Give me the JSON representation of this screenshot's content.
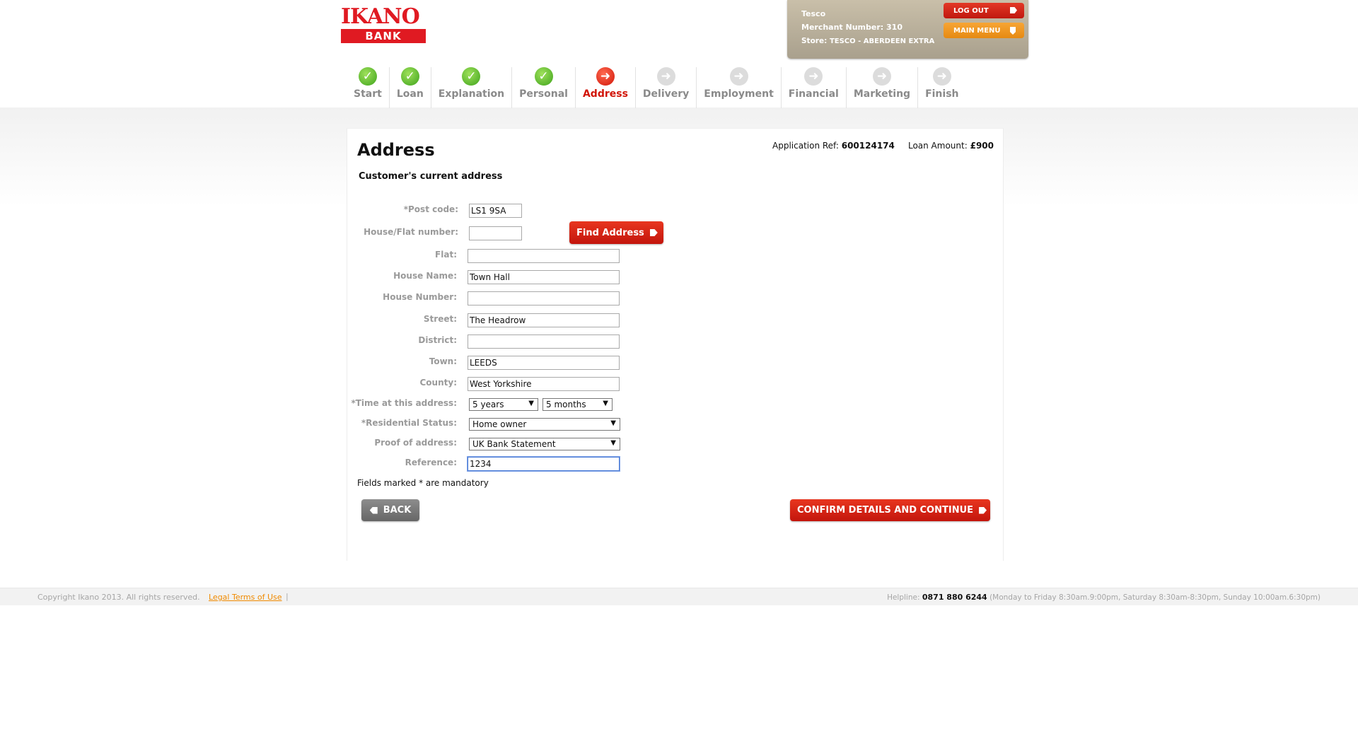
{
  "header": {
    "logo_top": "IKANO",
    "logo_bottom": "BANK",
    "merchant_name": "Tesco",
    "merchant_number_label": "Merchant Number:",
    "merchant_number": "310",
    "store_label": "Store:",
    "store_name": "TESCO - ABERDEEN EXTRA",
    "logout_label": "LOG OUT",
    "main_menu_label": "MAIN MENU"
  },
  "steps": [
    {
      "label": "Start",
      "status": "done",
      "icon": "check-icon"
    },
    {
      "label": "Loan",
      "status": "done",
      "icon": "check-icon"
    },
    {
      "label": "Explanation",
      "status": "done",
      "icon": "check-icon"
    },
    {
      "label": "Personal",
      "status": "done",
      "icon": "check-icon"
    },
    {
      "label": "Address",
      "status": "current",
      "icon": "arrow-right-icon"
    },
    {
      "label": "Delivery",
      "status": "todo",
      "icon": "arrow-right-icon"
    },
    {
      "label": "Employment",
      "status": "todo",
      "icon": "arrow-right-icon"
    },
    {
      "label": "Financial",
      "status": "todo",
      "icon": "arrow-right-icon"
    },
    {
      "label": "Marketing",
      "status": "todo",
      "icon": "arrow-right-icon"
    },
    {
      "label": "Finish",
      "status": "todo",
      "icon": "arrow-right-icon"
    }
  ],
  "main": {
    "title": "Address",
    "app_ref_label": "Application Ref:",
    "app_ref": "600124174",
    "loan_amount_label": "Loan Amount:",
    "loan_amount": "£900",
    "subheading": "Customer's current address"
  },
  "form": {
    "postcode_label": "*Post code:",
    "postcode_value": "LS1 9SA",
    "house_flat_number_label": "House/Flat number:",
    "house_flat_number_value": "",
    "find_address_label": "Find Address",
    "flat_label": "Flat:",
    "flat_value": "",
    "house_name_label": "House Name:",
    "house_name_value": "Town Hall",
    "house_number_label": "House Number:",
    "house_number_value": "",
    "street_label": "Street:",
    "street_value": "The Headrow",
    "district_label": "District:",
    "district_value": "",
    "town_label": "Town:",
    "town_value": "LEEDS",
    "county_label": "County:",
    "county_value": "West Yorkshire",
    "time_label": "*Time at this address:",
    "time_years": "5 years",
    "time_months": "5 months",
    "residential_label": "*Residential Status:",
    "residential_value": "Home owner",
    "proof_label": "Proof of address:",
    "proof_value": "UK Bank Statement",
    "reference_label": "Reference:",
    "reference_value": "1234",
    "mandatory_note": "Fields marked * are mandatory",
    "back_label": "BACK",
    "confirm_label": "CONFIRM DETAILS AND CONTINUE"
  },
  "footer": {
    "copyright": "Copyright Ikano 2013. All rights reserved.",
    "legal_link": "Legal Terms of Use",
    "separator": "|",
    "helpline_label": "Helpline:",
    "helpline_number": "0871 880 6244",
    "helpline_hours": "(Monday to Friday 8:30am.9:00pm, Saturday 8:30am-8:30pm, Sunday 10:00am.6:30pm)"
  },
  "colors": {
    "brand_red": "#e01a22",
    "accent_orange": "#f7a535",
    "done_green": "#3ea31c"
  }
}
